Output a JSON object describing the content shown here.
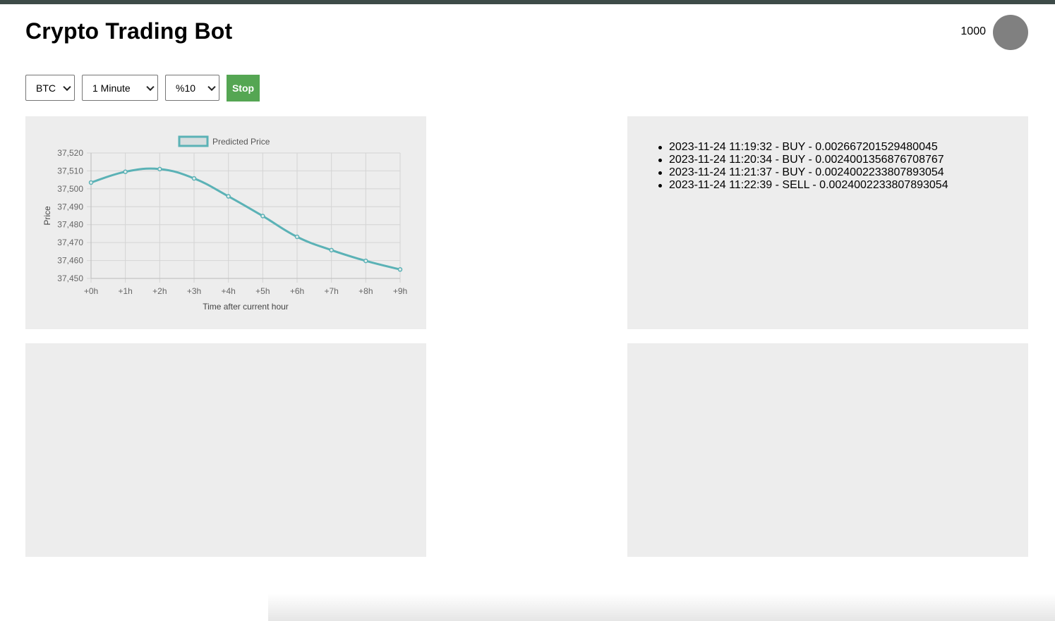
{
  "header": {
    "title": "Crypto Trading Bot",
    "balance": "1000"
  },
  "controls": {
    "coin": "BTC",
    "interval": "1 Minute",
    "percent": "%10",
    "stop_label": "Stop"
  },
  "trades": [
    "2023-11-24 11:19:32 - BUY - 0.002667201529480045",
    "2023-11-24 11:20:34 - BUY - 0.0024001356876708767",
    "2023-11-24 11:21:37 - BUY - 0.0024002233807893054",
    "2023-11-24 11:22:39 - SELL - 0.0024002233807893054"
  ],
  "chart_data": {
    "type": "line",
    "title": "",
    "xlabel": "Time after current hour",
    "ylabel": "Price",
    "categories": [
      "+0h",
      "+1h",
      "+2h",
      "+3h",
      "+4h",
      "+5h",
      "+6h",
      "+7h",
      "+8h",
      "+9h"
    ],
    "series": [
      {
        "name": "Predicted Price",
        "values": [
          37503.5,
          37509.5,
          37511,
          37505.8,
          37495.8,
          37484.8,
          37473.2,
          37465.8,
          37459.8,
          37455
        ]
      }
    ],
    "ylim": [
      37450,
      37520
    ],
    "yticks": [
      37450,
      37460,
      37470,
      37480,
      37490,
      37500,
      37510,
      37520
    ],
    "ytick_labels": [
      "37,450",
      "37,460",
      "37,470",
      "37,480",
      "37,490",
      "37,500",
      "37,510",
      "37,520"
    ],
    "grid": true,
    "legend": "top",
    "line_color": "#5bb2b6"
  }
}
